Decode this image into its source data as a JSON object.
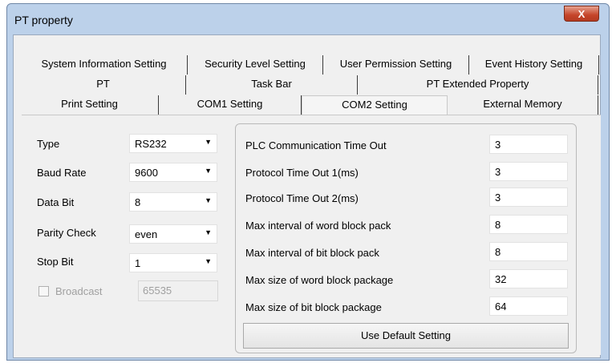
{
  "window": {
    "title": "PT property",
    "close_label": "X"
  },
  "tabs": {
    "row1": [
      "System Information Setting",
      "Security Level Setting",
      "User Permission Setting",
      "Event History Setting"
    ],
    "row2": [
      "PT",
      "Task Bar",
      "PT Extended Property"
    ],
    "row3": [
      "Print Setting",
      "COM1 Setting",
      "COM2 Setting",
      "External Memory"
    ],
    "active": "COM2 Setting"
  },
  "port": {
    "type_label": "Type",
    "type_value": "RS232",
    "baud_label": "Baud Rate",
    "baud_value": "9600",
    "databit_label": "Data Bit",
    "databit_value": "8",
    "parity_label": "Parity Check",
    "parity_value": "even",
    "stopbit_label": "Stop Bit",
    "stopbit_value": "1",
    "broadcast_label": "Broadcast",
    "broadcast_value": "65535"
  },
  "timeouts": {
    "plc_label": "PLC Communication Time Out",
    "plc_value": "3",
    "proto1_label": "Protocol Time Out 1(ms)",
    "proto1_value": "3",
    "proto2_label": "Protocol Time Out 2(ms)",
    "proto2_value": "3",
    "word_interval_label": "Max interval of word block pack",
    "word_interval_value": "8",
    "bit_interval_label": "Max interval of bit block pack",
    "bit_interval_value": "8",
    "word_size_label": "Max size of word block package",
    "word_size_value": "32",
    "bit_size_label": "Max size of bit block package",
    "bit_size_value": "64"
  },
  "buttons": {
    "default_label": "Use Default Setting"
  }
}
